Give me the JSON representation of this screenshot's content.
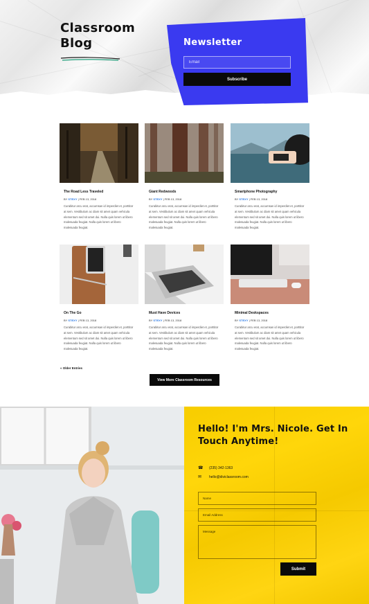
{
  "blog": {
    "title": "Classroom\nBlog"
  },
  "newsletter": {
    "heading": "Newsletter",
    "email_placeholder": "Email",
    "subscribe_label": "Subscribe"
  },
  "posts": [
    {
      "title": "The Road Less Traveled",
      "meta_by": "BY",
      "author": "STEXY",
      "date": "FEB 13, 2018",
      "excerpt": "Curabitur arcu erat, accumsan id imperdiet et, porttitor at sem. Vestibulum ac diam sit amet quam vehicula elementum sed sit amet dui. Nulla quis lorem ut libero malesuada feugiat. Nulla quis lorem ut libero malesuada feugiat."
    },
    {
      "title": "Giant Redwoods",
      "meta_by": "BY",
      "author": "STEXY",
      "date": "FEB 13, 2018",
      "excerpt": "Curabitur arcu erat, accumsan id imperdiet et, porttitor at sem. Vestibulum ac diam sit amet quam vehicula elementum sed sit amet dui. Nulla quis lorem ut libero malesuada feugiat. Nulla quis lorem ut libero malesuada feugiat."
    },
    {
      "title": "Smartphone Photography",
      "meta_by": "BY",
      "author": "STEXY",
      "date": "FEB 13, 2018",
      "excerpt": "Curabitur arcu erat, accumsan id imperdiet et, porttitor at sem. Vestibulum ac diam sit amet quam vehicula elementum sed sit amet dui. Nulla quis lorem ut libero malesuada feugiat. Nulla quis lorem ut libero malesuada feugiat."
    },
    {
      "title": "On The Go",
      "meta_by": "BY",
      "author": "STEXY",
      "date": "FEB 13, 2018",
      "excerpt": "Curabitur arcu erat, accumsan id imperdiet et, porttitor at sem. Vestibulum ac diam sit amet quam vehicula elementum sed sit amet dui. Nulla quis lorem ut libero malesuada feugiat. Nulla quis lorem ut libero malesuada feugiat."
    },
    {
      "title": "Must Have Devices",
      "meta_by": "BY",
      "author": "STEXY",
      "date": "FEB 13, 2018",
      "excerpt": "Curabitur arcu erat, accumsan id imperdiet et, porttitor at sem. Vestibulum ac diam sit amet quam vehicula elementum sed sit amet dui. Nulla quis lorem ut libero malesuada feugiat. Nulla quis lorem ut libero malesuada feugiat."
    },
    {
      "title": "Minimal Deskspaces",
      "meta_by": "BY",
      "author": "STEXY",
      "date": "FEB 13, 2018",
      "excerpt": "Curabitur arcu erat, accumsan id imperdiet et, porttitor at sem. Vestibulum ac diam sit amet quam vehicula elementum sed sit amet dui. Nulla quis lorem ut libero malesuada feugiat. Nulla quis lorem ut libero malesuada feugiat."
    }
  ],
  "pagination": {
    "older_label": "« Older Entries"
  },
  "cta": {
    "more_label": "View More Classroom Resources"
  },
  "contact": {
    "heading": "Hello! I'm Mrs. Nicole. Get In Touch Anytime!",
    "phone": "(235) 342-1363",
    "email": "hello@diviclassroom.com",
    "name_placeholder": "Name",
    "email_placeholder": "Email Address",
    "message_placeholder": "Message",
    "submit_label": "Submit"
  },
  "colors": {
    "accent_blue": "#3a3af0",
    "contact_yellow": "#ffd60a",
    "link_blue": "#2d7be5"
  }
}
